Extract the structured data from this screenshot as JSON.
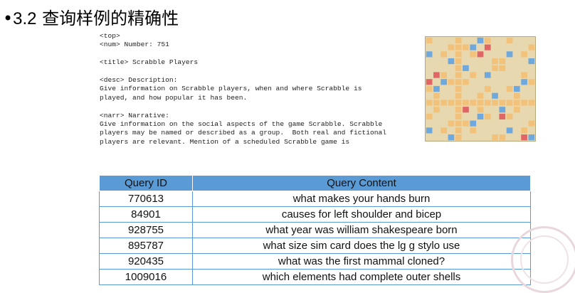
{
  "slide": {
    "bullet": "•",
    "section_number": "3.2",
    "title": "查询样例的精确性"
  },
  "trec_topic": {
    "text": "<top>\n<num> Number: 751\n\n<title> Scrabble Players\n\n<desc> Description:\nGive information on Scrabble players, when and where Scrabble is\nplayed, and how popular it has been.\n\n<narr> Narrative:\nGive information on the social aspects of the game Scrabble. Scrabble\nplayers may be named or described as a group.  Both real and fictional\nplayers are relevant. Mention of a scheduled Scrabble game is"
  },
  "table": {
    "headers": [
      "Query ID",
      "Query Content"
    ],
    "rows": [
      [
        "770613",
        "what makes your hands burn"
      ],
      [
        "84901",
        "causes for left shoulder and bicep"
      ],
      [
        "928755",
        "what year was william shakespeare born"
      ],
      [
        "895787",
        "what size sim card does the lg g stylo use"
      ],
      [
        "920435",
        "what was the first mammal cloned?"
      ],
      [
        "1009016",
        "which elements had complete outer shells"
      ]
    ]
  },
  "colors": {
    "table_header": "#5b9bd5",
    "board_bg": "#e7d8b0",
    "tile": "#f3c27a",
    "premium_blue": "#6fa8dc",
    "premium_red": "#e06666"
  }
}
